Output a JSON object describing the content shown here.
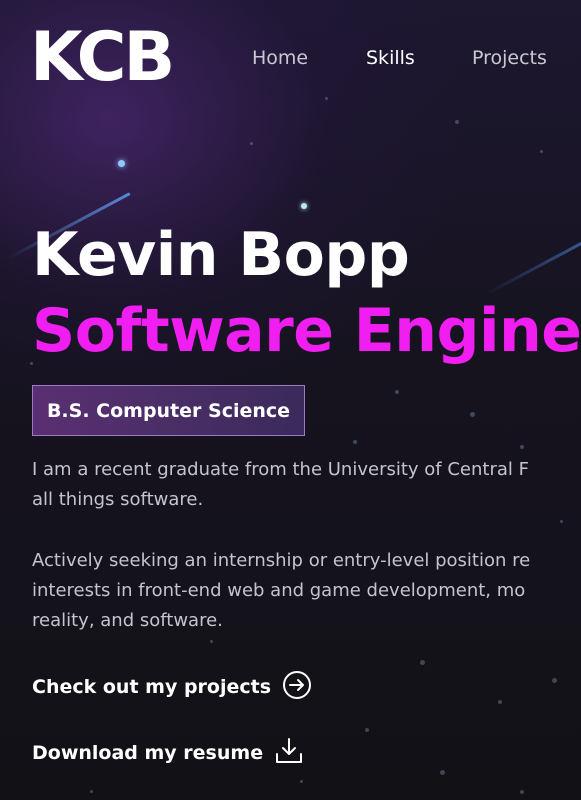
{
  "header": {
    "logo": "KCB",
    "nav": [
      {
        "label": "Home"
      },
      {
        "label": "Skills"
      },
      {
        "label": "Projects"
      }
    ]
  },
  "hero": {
    "name": "Kevin Bopp",
    "role": "Software Engine",
    "degree_badge": "B.S. Computer Science",
    "paragraphs": [
      {
        "lines": [
          "I am a recent graduate from the University of Central F",
          "all things software."
        ]
      },
      {
        "lines": [
          "Actively seeking an internship or entry-level position re",
          "interests in front-end web and game development, mo",
          "reality, and software."
        ]
      }
    ],
    "cta_projects": "Check out my projects",
    "cta_resume": "Download my resume"
  },
  "icons": {
    "projects_link": "arrow-right-circle-icon",
    "resume_link": "download-icon"
  },
  "colors": {
    "accent": "#f01ef0",
    "background": "#121116",
    "badge": "#4a2e66"
  }
}
